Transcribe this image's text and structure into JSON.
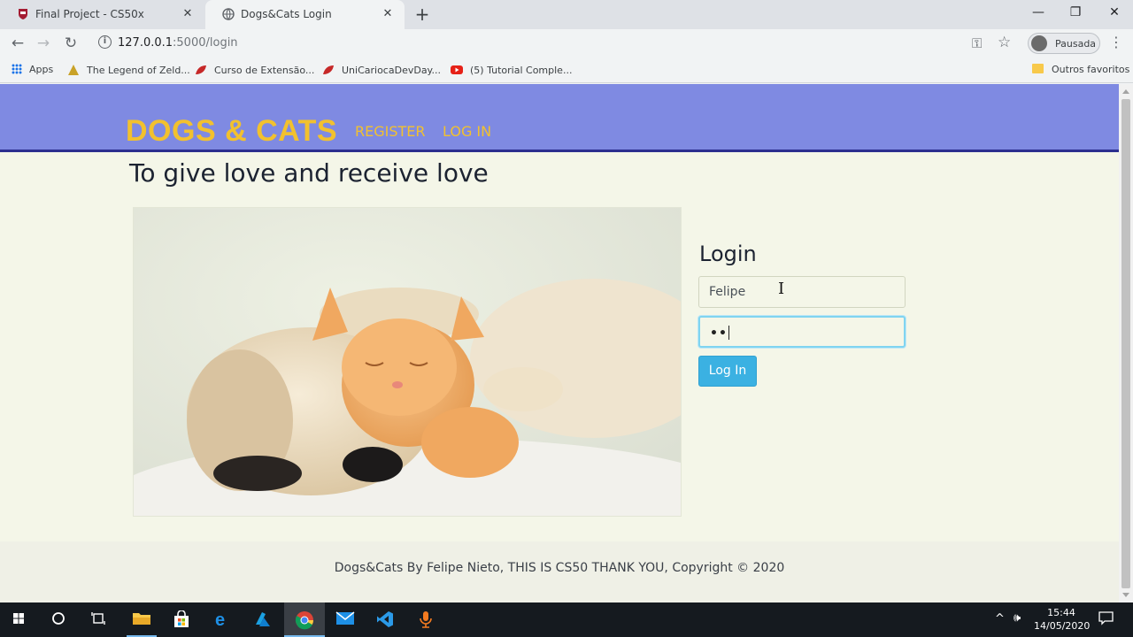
{
  "browser": {
    "tabs": [
      {
        "title": "Final Project - CS50x",
        "active": false
      },
      {
        "title": "Dogs&Cats Login",
        "active": true
      }
    ],
    "url": {
      "host": "127.0.0.1",
      "path": ":5000/login"
    },
    "profile_label": "Pausada",
    "bookmarks": [
      {
        "label": "Apps"
      },
      {
        "label": "The Legend of Zeld..."
      },
      {
        "label": "Curso de Extensão..."
      },
      {
        "label": "UniCariocaDevDay..."
      },
      {
        "label": "(5) Tutorial Comple..."
      }
    ],
    "other_bookmarks": "Outros favoritos"
  },
  "page": {
    "brand": "DOGS & CATS",
    "nav": {
      "register": "REGISTER",
      "login": "LOG IN"
    },
    "tagline": "To give love and receive love",
    "login_form": {
      "title": "Login",
      "username_value": "Felipe",
      "password_value": "••",
      "submit_label": "Log In"
    },
    "footer": "Dogs&Cats By Felipe Nieto, THIS IS CS50 THANK YOU, Copyright © 2020"
  },
  "taskbar": {
    "time": "15:44",
    "date": "14/05/2020"
  },
  "colors": {
    "nav_bg": "#7f8ae2",
    "brand_yellow": "#f2c12e",
    "page_bg": "#f4f6e8",
    "button_blue": "#3bb1e2"
  }
}
